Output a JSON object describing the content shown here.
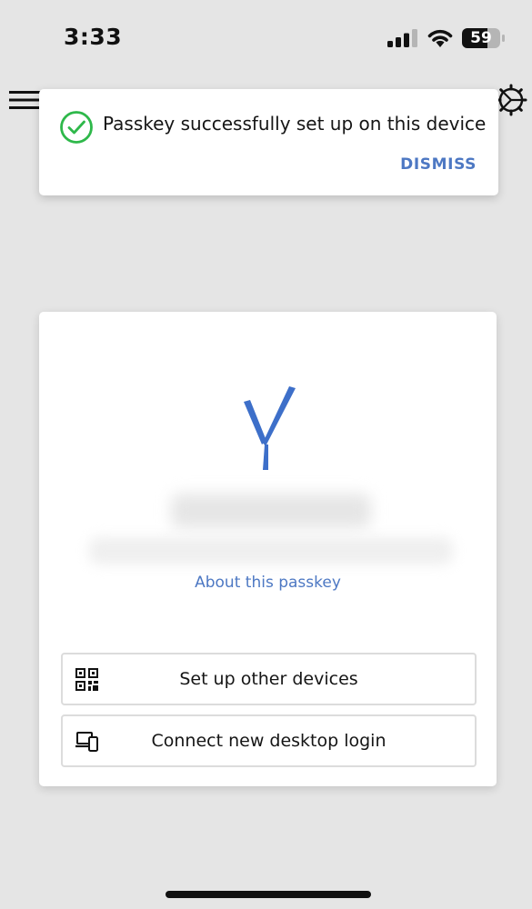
{
  "status_bar": {
    "time": "3:33",
    "battery": "59",
    "icons": [
      "signal-icon",
      "wifi-icon",
      "battery-icon"
    ]
  },
  "app_bar": {
    "icons": [
      "menu-icon",
      "settings-icon"
    ]
  },
  "toast": {
    "message": "Passkey successfully set up on this device",
    "dismiss_label": "DISMISS",
    "icon": "check-circle-icon"
  },
  "card": {
    "about_link": "About this passkey",
    "actions": [
      {
        "label": "Set up other devices",
        "icon": "qr-code-icon"
      },
      {
        "label": "Connect new desktop login",
        "icon": "devices-icon"
      }
    ]
  },
  "colors": {
    "background": "#e5e5e5",
    "accent": "#4d78c3",
    "success": "#2eb84a",
    "logo": "#3d6fc9"
  }
}
